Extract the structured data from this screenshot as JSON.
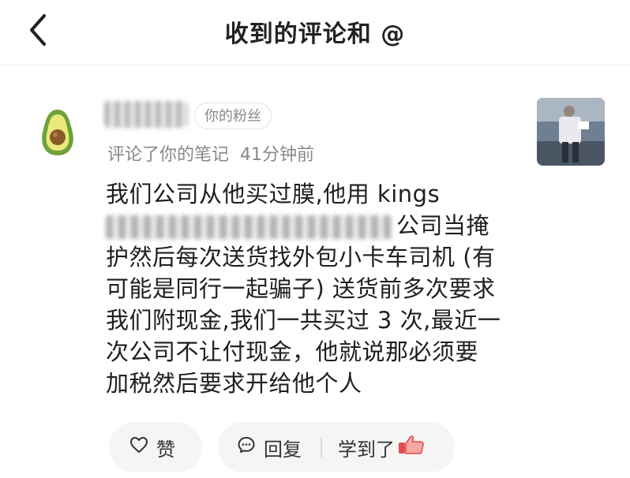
{
  "header": {
    "title": "收到的评论和 @"
  },
  "comment": {
    "badge": "你的粉丝",
    "action": "评论了你的笔记",
    "time": "41分钟前",
    "lines": [
      "我们公司从他买过膜,他用 kings",
      "公司当掩",
      "护然后每次送货找外包小卡车司机 (有",
      "可能是同行一起骗子) 送货前多次要求",
      "我们附现金,我们一共买过 3 次,最近一",
      "次公司不让付现金，他就说那必须要",
      "加税然后要求开给他个人"
    ]
  },
  "actions": {
    "like_label": "赞",
    "reply_label": "回复",
    "learned_label": "学到了"
  },
  "icons": {
    "back": "chevron-left-icon",
    "avatar": "avocado-icon",
    "like": "heart-icon",
    "reply": "comment-bubble-icon",
    "learned": "thumbs-up-emoji-icon"
  }
}
